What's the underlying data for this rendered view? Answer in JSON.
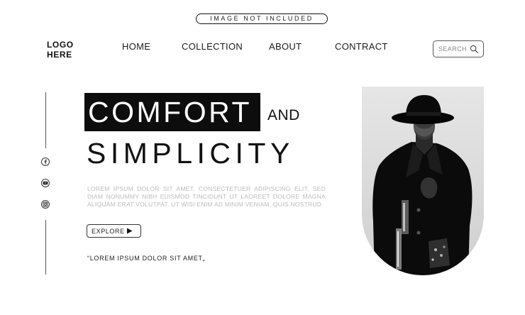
{
  "badge": "IMAGE NOT INCLUDED",
  "logo": {
    "line1": "LOGO",
    "line2": "HERE"
  },
  "nav": {
    "home": "HOME",
    "collection": "COLLECTION",
    "about": "ABOUT",
    "contract": "CONTRACT"
  },
  "search": {
    "placeholder": "SEARCH"
  },
  "hero": {
    "title_highlight": "COMFORT",
    "title_and": "AND",
    "title_line2": "SIMPLICITY",
    "paragraph": "LOREM IPSUM DOLOR SIT AMET, CONSECTETUER ADIPISCING ELIT, SED DIAM NONUMMY NIBH EUISMOD TINCIDUNT UT LAOREET DOLORE MAGNA ALIQUAM ERAT VOLUTPAT. UT WISI ENIM AD MINIM VENIAM, QUIS NOSTRUD",
    "explore_label": "EXPLORE",
    "quote": "“LOREM IPSUM DOLOR SIT AMET„"
  },
  "social": [
    {
      "icon": "facebook-icon"
    },
    {
      "icon": "youtube-icon"
    },
    {
      "icon": "instagram-icon"
    }
  ],
  "colors": {
    "background": "#ffffff",
    "text": "#111111",
    "highlight_bg": "#0d0d0d",
    "muted_text": "#bcbcbc"
  }
}
